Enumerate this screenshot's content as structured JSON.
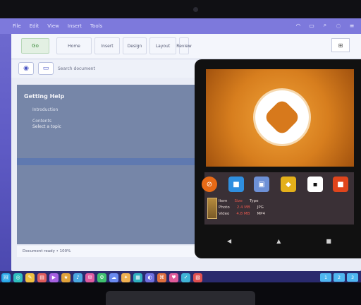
{
  "menubar": {
    "items": [
      "File",
      "Edit",
      "View",
      "Insert",
      "Tools"
    ]
  },
  "window": {
    "ribbon": {
      "green_button": "Go",
      "group_labels": [
        "Home",
        "Insert",
        "Design",
        "Layout",
        "Review"
      ],
      "right_button": "⊞"
    },
    "toolbar": {
      "text": "Search document"
    },
    "doc": {
      "title": "Getting Help",
      "subtitle": "Introduction",
      "line1": "Contents",
      "line2": "Select a topic"
    },
    "status": {
      "text": "Document ready  •  100%"
    }
  },
  "tablet": {
    "apps": [
      "⊘",
      "■",
      "▣",
      "◆",
      "▪",
      "■"
    ],
    "app_colors": [
      "#e86a16",
      "#2f8fe0",
      "#6d90d6",
      "#e4b01a",
      "#ffffff",
      "#e0451c"
    ],
    "list": [
      [
        "Item",
        "Size",
        "Type"
      ],
      [
        "Photo",
        "2.4 MB",
        "JPG"
      ],
      [
        "Video",
        "4.8 MB",
        "MP4"
      ]
    ],
    "softbar": [
      "◀",
      "▲",
      "■"
    ]
  },
  "dock": {
    "items": [
      "🖼",
      "◎",
      "✎",
      "▤",
      "▶",
      "★",
      "♪",
      "✉",
      "⚙",
      "☁",
      "✦",
      "▦",
      "◐",
      "⌘",
      "♥",
      "✓",
      "▧"
    ],
    "item_colors": [
      "#27a7e7",
      "#2fbfbf",
      "#f0c040",
      "#e05d5d",
      "#a660e0",
      "#e0a23a",
      "#4aa8e0",
      "#e05ca0",
      "#40c070",
      "#6a8af0",
      "#f0b050",
      "#30b0c0",
      "#7070e0",
      "#e07040",
      "#e05a9a",
      "#3fb3d5",
      "#e05050"
    ],
    "right": [
      "1",
      "2",
      "3"
    ]
  }
}
